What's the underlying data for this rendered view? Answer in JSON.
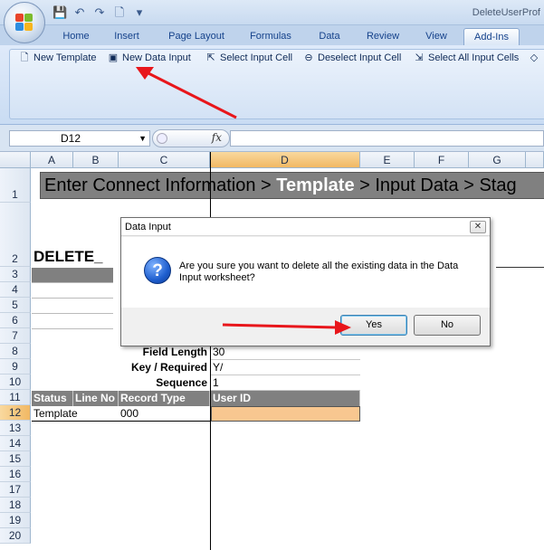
{
  "window": {
    "title": "DeleteUserProf"
  },
  "tabs": [
    "Home",
    "Insert",
    "Page Layout",
    "Formulas",
    "Data",
    "Review",
    "View",
    "Add-Ins"
  ],
  "ribbon": {
    "new_template": "New Template",
    "new_data_input": "New Data Input",
    "select_input_cell": "Select Input Cell",
    "deselect_input_cell": "Deselect Input Cell",
    "select_all_input_cells": "Select All Input Cells"
  },
  "formula_bar": {
    "name_box": "D12",
    "fx": "fx",
    "value": ""
  },
  "sheet": {
    "columns": [
      "A",
      "B",
      "C",
      "D",
      "E",
      "F",
      "G"
    ],
    "rows": [
      "1",
      "2",
      "3",
      "4",
      "5",
      "6",
      "7",
      "8",
      "9",
      "10",
      "11",
      "12",
      "13",
      "14",
      "15",
      "16",
      "17",
      "18",
      "19",
      "20"
    ],
    "banner": {
      "part1": "Enter Connect Information > ",
      "current": "Template",
      "part2": " > Input Data > Stag"
    },
    "delete_label": "DELETE_",
    "field_length_label": "Field Length",
    "field_length_value": "30",
    "key_required_label": "Key / Required",
    "key_required_value": "Y/",
    "sequence_label": "Sequence",
    "sequence_value": "1",
    "header_status": "Status",
    "header_line_no": "Line No",
    "header_record_type": "Record Type",
    "header_user_id": "User ID",
    "row12_status": "Template",
    "row12_record_type": "000"
  },
  "dialog": {
    "title": "Data Input",
    "message": "Are you sure you want to delete all the existing data in the Data Input worksheet?",
    "yes": "Yes",
    "no": "No",
    "close": "✕"
  },
  "colors": {
    "annotation_arrow": "#e8161b",
    "selection": "#f8c790",
    "header_gray": "#808080"
  }
}
